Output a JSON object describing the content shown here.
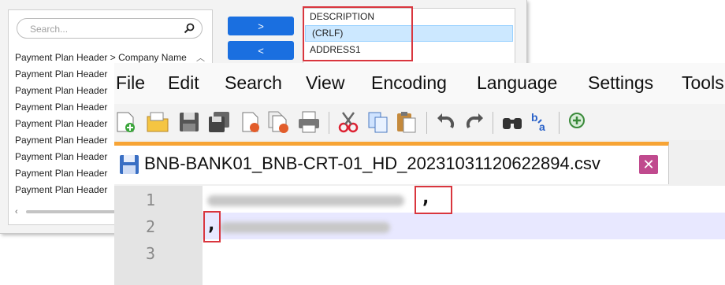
{
  "mapper": {
    "search_placeholder": "Search...",
    "fields": [
      "Payment Plan Header > Company Name",
      "Payment Plan Header",
      "Payment Plan Header",
      "Payment Plan Header",
      "Payment Plan Header",
      "Payment Plan Header",
      "Payment Plan Header",
      "Payment Plan Header",
      "Payment Plan Header"
    ],
    "add_label": ">",
    "remove_label": "<",
    "selected": [
      {
        "label": "DESCRIPTION",
        "active": false
      },
      {
        "label": "(CRLF)",
        "active": true
      },
      {
        "label": "ADDRESS1",
        "active": false
      }
    ]
  },
  "npp": {
    "menu": [
      "File",
      "Edit",
      "Search",
      "View",
      "Encoding",
      "Language",
      "Settings",
      "Tools"
    ],
    "tab_title": "BNB-BANK01_BNB-CRT-01_HD_20231031120622894.csv",
    "tab_close": "✕",
    "line_numbers": [
      "1",
      "2",
      "3"
    ],
    "comma": ","
  },
  "colors": {
    "accent_blue": "#1a6fe0",
    "highlight_red": "#d9363e",
    "tab_orange": "#f7a435",
    "selection": "#cce8ff"
  }
}
